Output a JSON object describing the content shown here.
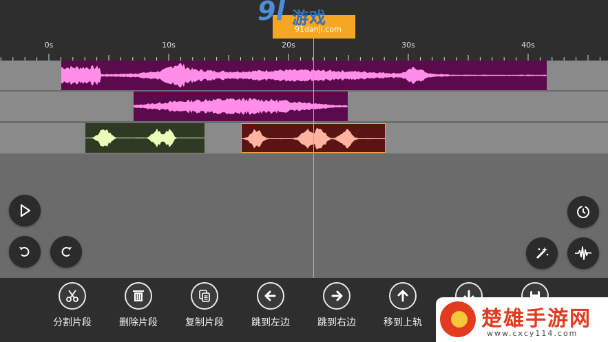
{
  "ruler": {
    "ticks": [
      "0s",
      "10s",
      "20s",
      "30s",
      "40s"
    ]
  },
  "tracks": [
    {
      "clips": [
        {
          "color": "#5b0a4c",
          "wave": "#ff8ee8"
        }
      ]
    },
    {
      "clips": [
        {
          "color": "#5b0a4c",
          "wave": "#ff8ee8"
        }
      ]
    },
    {
      "clips": [
        {
          "color": "#2f3a24",
          "wave": "#e9ffb8"
        },
        {
          "color": "#5a1414",
          "wave": "#ffb3a0"
        }
      ]
    }
  ],
  "controls": {
    "play": "play-icon",
    "undo": "undo-icon",
    "redo": "redo-icon",
    "history": "clock-icon",
    "effects": "magic-wand-icon",
    "waveform": "waveform-icon"
  },
  "toolbar": {
    "split": "分割片段",
    "delete": "删除片段",
    "copy": "复制片段",
    "jump_left": "跳到左边",
    "jump_right": "跳到右边",
    "move_up": "移到上轨"
  },
  "watermark_top": {
    "big": "9l",
    "cn": "游戏",
    "url": "91danji.com"
  },
  "watermark_br": {
    "title": "楚雄手游网",
    "site": "www.cxcy114.com"
  },
  "colors": {
    "playhead": "#f7a030",
    "accent": "#f5a623"
  }
}
